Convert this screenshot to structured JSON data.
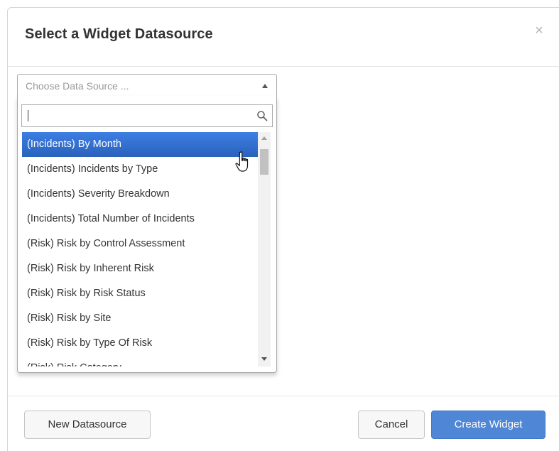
{
  "modal": {
    "title": "Select a Widget Datasource",
    "close_glyph": "×"
  },
  "select": {
    "placeholder": "Choose Data Source ...",
    "search_value": ""
  },
  "results": [
    "(Incidents) By Month",
    "(Incidents) Incidents by Type",
    "(Incidents) Severity Breakdown",
    "(Incidents) Total Number of Incidents",
    "(Risk) Risk by Control Assessment",
    "(Risk) Risk by Inherent Risk",
    "(Risk) Risk by Risk Status",
    "(Risk) Risk by Site",
    "(Risk) Risk by Type Of Risk",
    "(Risk) Risk Category"
  ],
  "highlighted_index": 0,
  "footer": {
    "new_label": "New Datasource",
    "cancel_label": "Cancel",
    "create_label": "Create Widget"
  },
  "colors": {
    "highlight": "#3875d7",
    "primary": "#4f86d6"
  },
  "icons": {
    "search": "search-icon",
    "close": "close-icon",
    "dropdown_arrow": "caret-up-icon",
    "pointer": "hand-pointer-icon"
  }
}
